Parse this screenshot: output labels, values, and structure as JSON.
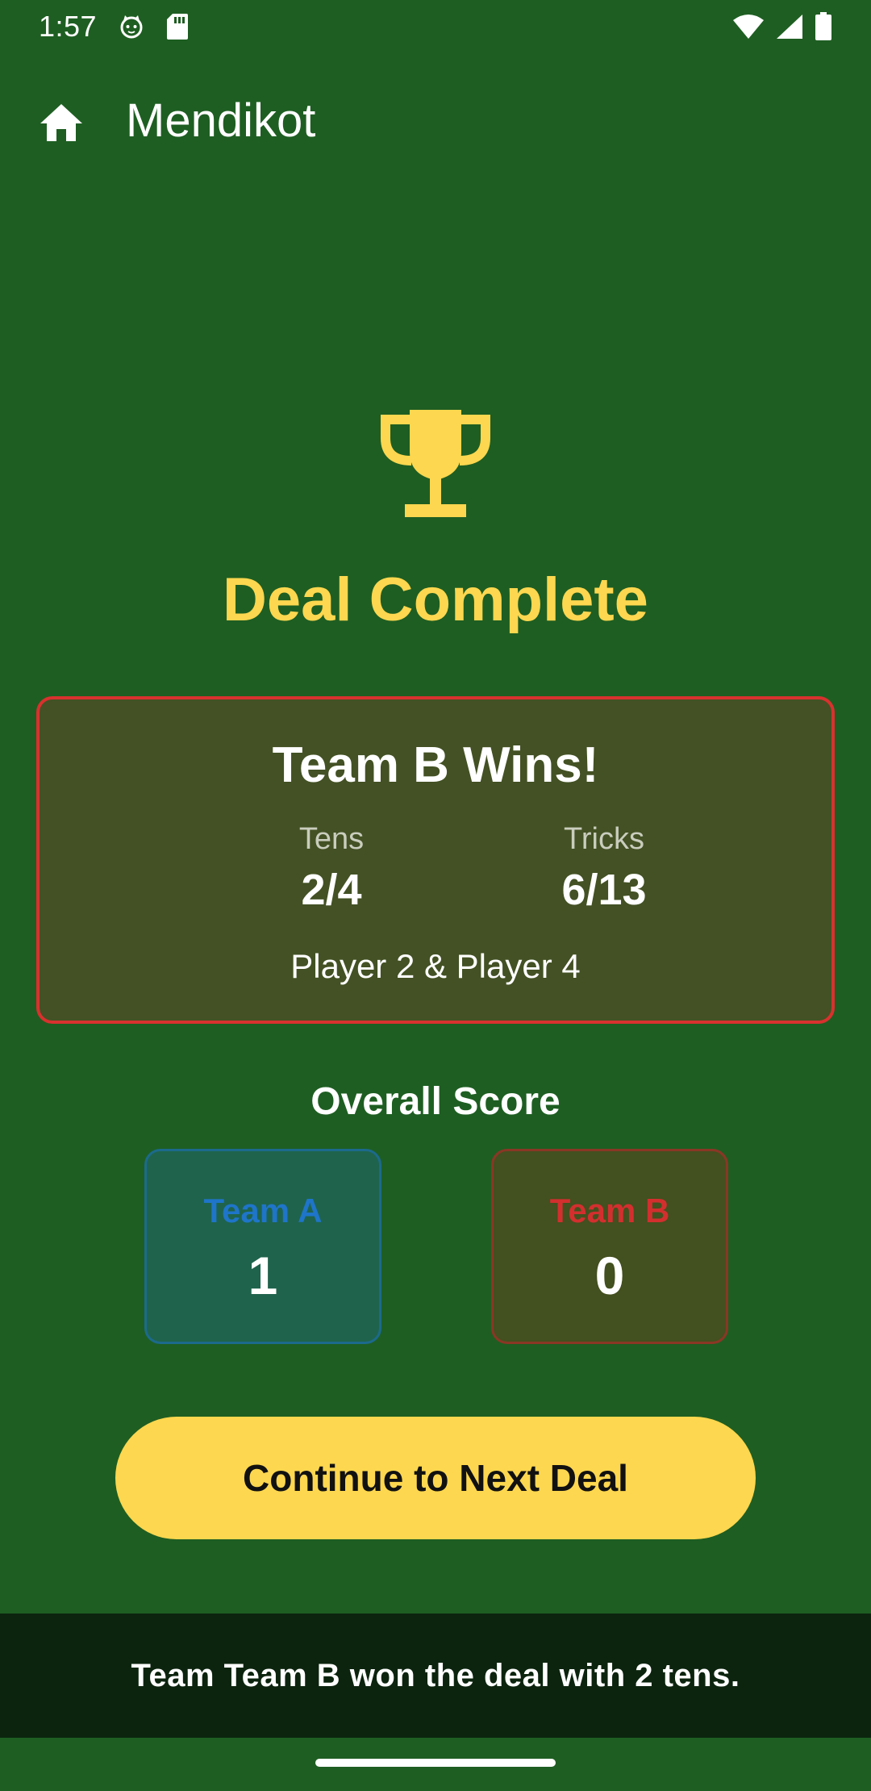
{
  "status_bar": {
    "time": "1:57",
    "icons": [
      "cat-notification-icon",
      "sd-card-icon",
      "wifi-icon",
      "signal-icon",
      "battery-icon"
    ]
  },
  "app_bar": {
    "title": "Mendikot",
    "home_icon": "home-icon"
  },
  "main": {
    "trophy_icon": "trophy-icon",
    "heading": "Deal Complete",
    "result_card": {
      "title": "Team B Wins!",
      "tens_label": "Tens",
      "tens_value": "2/4",
      "tricks_label": "Tricks",
      "tricks_value": "6/13",
      "players": "Player 2 & Player 4"
    },
    "overall_score": {
      "title": "Overall Score",
      "team_a": {
        "name": "Team A",
        "score": "1"
      },
      "team_b": {
        "name": "Team B",
        "score": "0"
      }
    },
    "continue_button": "Continue to Next Deal"
  },
  "snackbar": {
    "message": "Team Team B won the deal with 2 tens."
  },
  "colors": {
    "background": "#1e5e22",
    "accent_yellow": "#fdd74f",
    "team_a": "#1e75c9",
    "team_b": "#d32f2f",
    "card_border": "#d9312e"
  }
}
